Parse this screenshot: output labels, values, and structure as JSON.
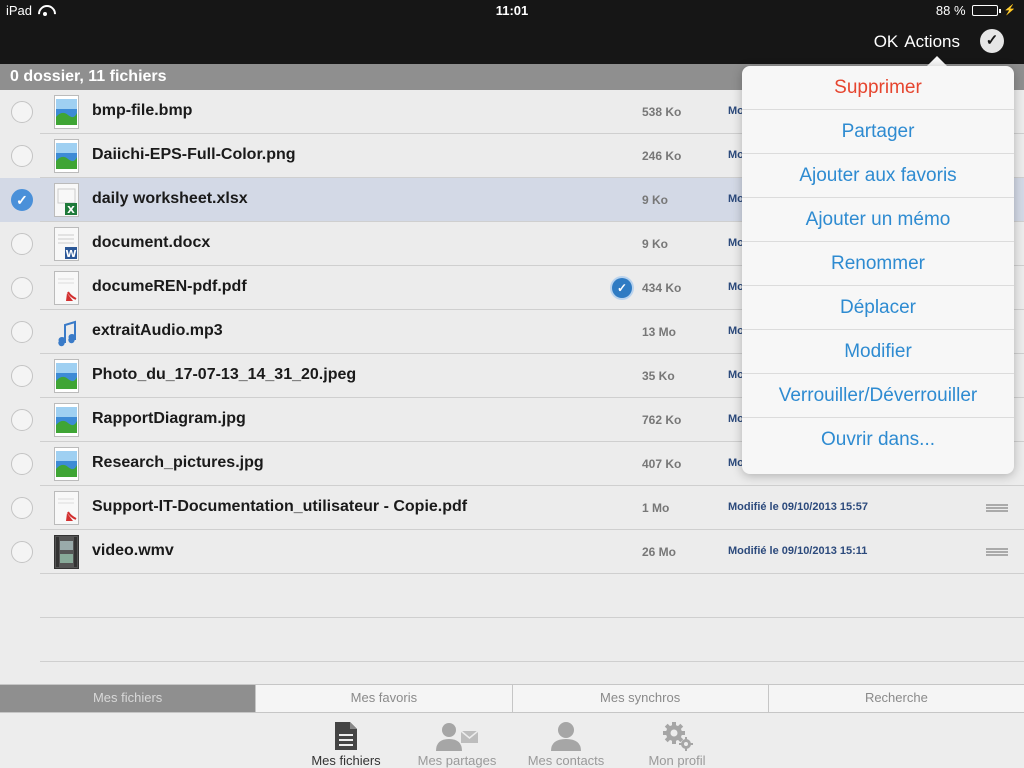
{
  "status": {
    "device": "iPad",
    "time": "11:01",
    "battery": "88 %",
    "battery_level": 0.88
  },
  "nav": {
    "ok_label": "OK",
    "actions_label": "Actions"
  },
  "section": {
    "title": "0 dossier, 11 fichiers"
  },
  "files": [
    {
      "name": "bmp-file.bmp",
      "size": "538 Ko",
      "date": "Mo",
      "type": "image"
    },
    {
      "name": "Daiichi-EPS-Full-Color.png",
      "size": "246 Ko",
      "date": "Mo",
      "type": "image"
    },
    {
      "name": "daily worksheet.xlsx",
      "size": "9 Ko",
      "date": "Mo",
      "type": "excel",
      "selected": true
    },
    {
      "name": "document.docx",
      "size": "9 Ko",
      "date": "Mo",
      "type": "word"
    },
    {
      "name": "documeREN-pdf.pdf",
      "size": "434 Ko",
      "date": "Mo",
      "type": "pdf",
      "synced": true
    },
    {
      "name": "extraitAudio.mp3",
      "size": "13 Mo",
      "date": "Mo",
      "type": "audio"
    },
    {
      "name": "Photo_du_17-07-13_14_31_20.jpeg",
      "size": "35 Ko",
      "date": "Mo",
      "type": "image"
    },
    {
      "name": "RapportDiagram.jpg",
      "size": "762 Ko",
      "date": "Mo",
      "type": "image"
    },
    {
      "name": "Research_pictures.jpg",
      "size": "407 Ko",
      "date": "Mo",
      "type": "image"
    },
    {
      "name": "Support-IT-Documentation_utilisateur - Copie.pdf",
      "size": "1 Mo",
      "date": "Modifié le 09/10/2013 15:57",
      "type": "pdf"
    },
    {
      "name": "video.wmv",
      "size": "26 Mo",
      "date": "Modifié le 09/10/2013 15:11",
      "type": "video"
    }
  ],
  "actions_menu": [
    {
      "label": "Supprimer",
      "danger": true
    },
    {
      "label": "Partager"
    },
    {
      "label": "Ajouter aux favoris"
    },
    {
      "label": "Ajouter un mémo"
    },
    {
      "label": "Renommer"
    },
    {
      "label": "Déplacer"
    },
    {
      "label": "Modifier"
    },
    {
      "label": "Verrouiller/Déverrouiller"
    },
    {
      "label": "Ouvrir dans..."
    }
  ],
  "segments": [
    {
      "label": "Mes fichiers",
      "active": true
    },
    {
      "label": "Mes favoris"
    },
    {
      "label": "Mes synchros"
    },
    {
      "label": "Recherche"
    }
  ],
  "tabs": [
    {
      "label": "Mes fichiers",
      "icon": "document-icon",
      "active": true
    },
    {
      "label": "Mes partages",
      "icon": "share-person-icon"
    },
    {
      "label": "Mes contacts",
      "icon": "contact-person-icon"
    },
    {
      "label": "Mon profil",
      "icon": "gear-icon"
    }
  ],
  "colors": {
    "accent": "#2e8bd1",
    "danger": "#e6452f",
    "selected_row": "#d3d9e6",
    "bar": "#161616"
  }
}
